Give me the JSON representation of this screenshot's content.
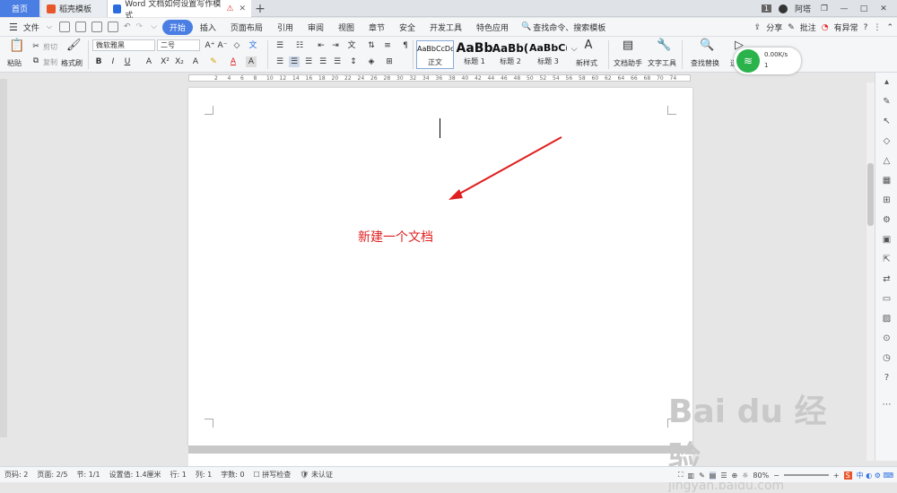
{
  "tabs": {
    "home": "首页",
    "template": "稻壳模板",
    "active": "Word 文档如何设置写作模式",
    "plus": "+"
  },
  "titlebar": {
    "page_num": "1",
    "user": "阿塔"
  },
  "menu": {
    "file": "文件",
    "items": [
      "开始",
      "插入",
      "页面布局",
      "引用",
      "审阅",
      "视图",
      "章节",
      "安全",
      "开发工具",
      "特色应用"
    ],
    "search": "查找命令、搜索模板",
    "share": "分享",
    "comment": "批注",
    "abnormal": "有异常",
    "help": "?"
  },
  "ribbon": {
    "paste": "粘贴",
    "cut": "剪切",
    "copy": "复制",
    "format_painter": "格式刷",
    "font": "微软雅黑",
    "size": "二号",
    "styles": [
      {
        "sample": "AaBbCcDd",
        "label": "正文"
      },
      {
        "sample": "AaBb",
        "label": "标题 1"
      },
      {
        "sample": "AaBb(",
        "label": "标题 2"
      },
      {
        "sample": "AaBbC(",
        "label": "标题 3"
      }
    ],
    "new_style": "新样式",
    "doc_helper": "文档助手",
    "text_tools": "文字工具",
    "find_replace": "查找替换",
    "select": "选"
  },
  "wifi": {
    "speed": "0.00K/s",
    "count": "1"
  },
  "ruler": {
    "marks": [
      "2",
      "4",
      "6",
      "8",
      "10",
      "12",
      "14",
      "16",
      "18",
      "20",
      "22",
      "24",
      "26",
      "28",
      "30",
      "32",
      "34",
      "36",
      "38",
      "40",
      "42",
      "44",
      "46",
      "48",
      "50",
      "52",
      "54",
      "56",
      "58",
      "60",
      "62",
      "64",
      "66",
      "68",
      "70",
      "74"
    ]
  },
  "document": {
    "annotation": "新建一个文档"
  },
  "status": {
    "page_count": "页码: 2",
    "page": "页面: 2/5",
    "section": "节: 1/1",
    "setting": "设置值: 1.4厘米",
    "row": "行: 1",
    "col": "列: 1",
    "chars": "字数: 0",
    "spell": "拼写检查",
    "cert": "未认证",
    "zoom": "80%"
  },
  "watermark": {
    "text": "Bai du 经验",
    "url": "jingyan.baidu.com"
  },
  "colors": {
    "accent": "#4a7ee3",
    "annotation": "#e02020",
    "wifi": "#29b34a"
  }
}
